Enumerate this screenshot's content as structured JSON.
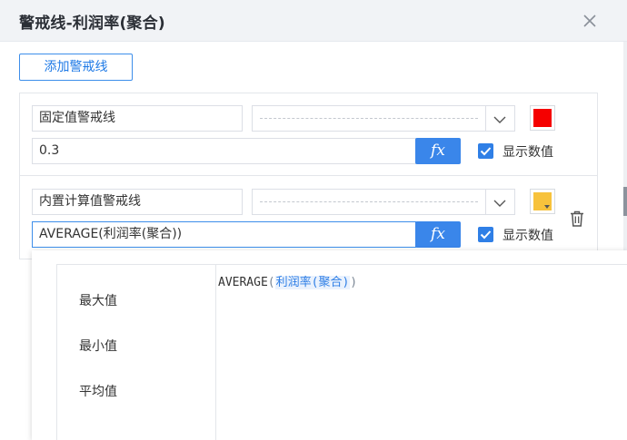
{
  "dialog": {
    "title": "警戒线-利润率(聚合)"
  },
  "toolbar": {
    "add_label": "添加警戒线"
  },
  "lines": [
    {
      "name": "固定值警戒线",
      "value": "0.3",
      "color": "#f50000",
      "show_value_label": "显示数值",
      "show_value_checked": true
    },
    {
      "name": "内置计算值警戒线",
      "value": "AVERAGE(利润率(聚合))",
      "color": "#f7c23c",
      "show_value_label": "显示数值",
      "show_value_checked": true
    }
  ],
  "formula_popup": {
    "functions": [
      "最大值",
      "最小值",
      "平均值"
    ],
    "code": {
      "fn": "AVERAGE",
      "open": "(",
      "arg": "利润率(聚合)",
      "close": ")"
    }
  },
  "colors": {
    "accent": "#3a86ea",
    "header_bg": "#f1f3f6"
  }
}
